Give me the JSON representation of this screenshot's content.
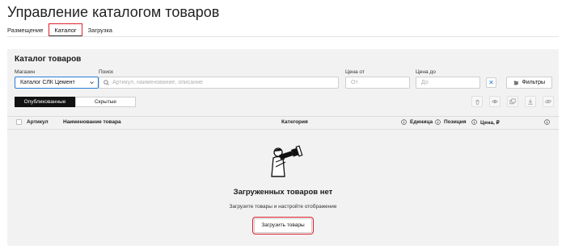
{
  "page_title": "Управление каталогом товаров",
  "tabs": [
    {
      "label": "Размещение",
      "active": false
    },
    {
      "label": "Каталог",
      "active": true
    },
    {
      "label": "Загрузка",
      "active": false
    }
  ],
  "panel": {
    "title": "Каталог товаров",
    "store": {
      "label": "Магазин",
      "value": "Каталог СЛК Цемент"
    },
    "search": {
      "label": "Поиск",
      "placeholder": "Артикул, наименование, описание"
    },
    "price_from": {
      "label": "Цена от",
      "placeholder": "От"
    },
    "price_to": {
      "label": "Цена до",
      "placeholder": "До"
    },
    "filters_button": "Фильтры",
    "segments": [
      {
        "label": "Опубликованные",
        "active": true
      },
      {
        "label": "Скрытые",
        "active": false
      }
    ],
    "actions": [
      "trash-icon",
      "eye-icon",
      "copy-icon",
      "download-icon",
      "link-icon"
    ],
    "table_columns": [
      "Артикул",
      "Наименование товара",
      "Категория",
      "Единица",
      "Позиция",
      "Цена, ₽"
    ],
    "empty_state": {
      "title": "Загруженных товаров нет",
      "subtitle": "Загрузите товары и настройте отображение",
      "button": "Загрузить товары"
    }
  },
  "colors": {
    "accent": "#2a7cd6",
    "highlight": "#e0202a",
    "panel_bg": "#f2f2f2"
  }
}
